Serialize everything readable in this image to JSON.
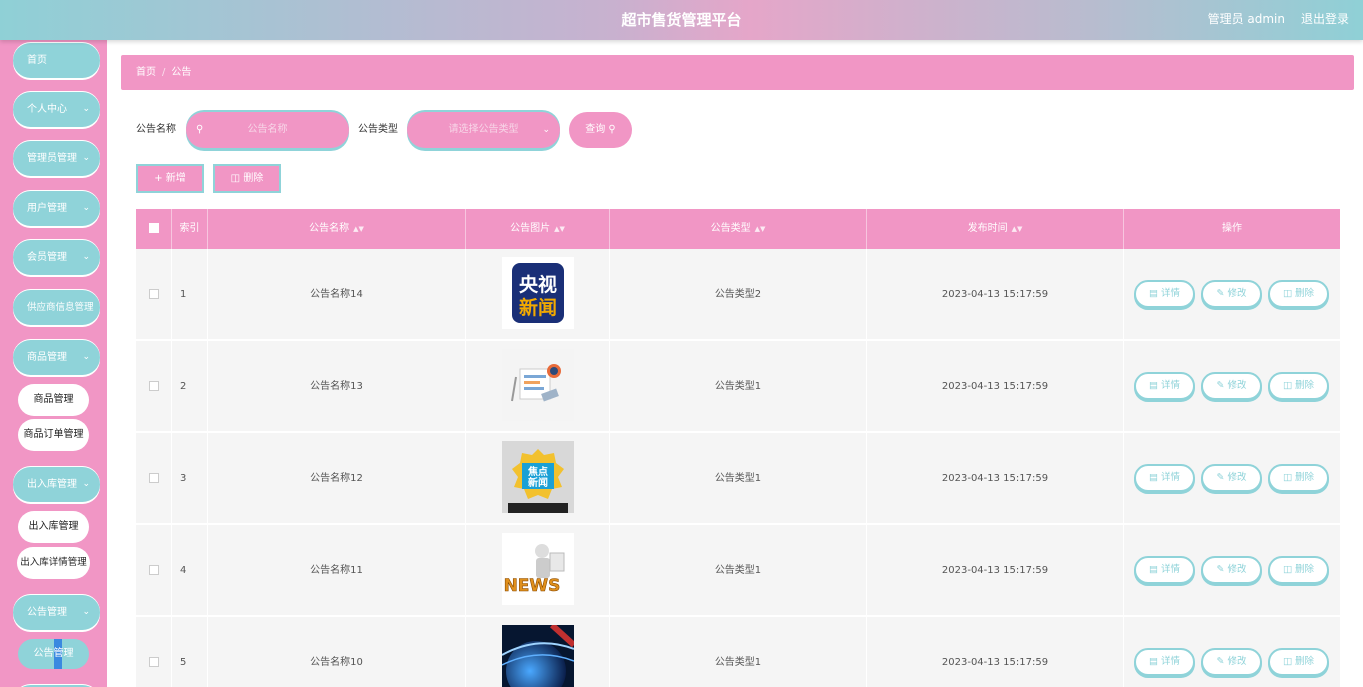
{
  "app": {
    "title": "超市售货管理平台",
    "admin_label": "管理员 admin",
    "logout": "退出登录"
  },
  "sidebar": {
    "items": [
      {
        "label": "首页"
      },
      {
        "label": "个人中心"
      },
      {
        "label": "管理员管理"
      },
      {
        "label": "用户管理"
      },
      {
        "label": "会员管理"
      },
      {
        "label": "供应商信息管理"
      },
      {
        "label": "商品管理"
      },
      {
        "label": "出入库管理"
      },
      {
        "label": "公告管理"
      }
    ],
    "sub_items": [
      {
        "label": "商品管理"
      },
      {
        "label": "商品订单管理"
      },
      {
        "label": "出入库管理"
      },
      {
        "label": "出入库详情管理"
      },
      {
        "label": "公告管理"
      }
    ]
  },
  "breadcrumb": {
    "home": "首页",
    "current": "公告"
  },
  "search": {
    "name_label": "公告名称",
    "name_placeholder": "公告名称",
    "type_label": "公告类型",
    "type_placeholder": "请选择公告类型",
    "query_label": "查询"
  },
  "actions": {
    "add_label": "新增",
    "delete_label": "删除"
  },
  "table": {
    "columns": [
      "索引",
      "公告名称",
      "公告图片",
      "公告类型",
      "发布时间",
      "操作"
    ],
    "op_labels": {
      "detail": "详情",
      "edit": "修改",
      "delete": "删除"
    },
    "rows": [
      {
        "index": "1",
        "name": "公告名称14",
        "image": "央视新闻",
        "type": "公告类型2",
        "time": "2023-04-13 15:17:59"
      },
      {
        "index": "2",
        "name": "公告名称13",
        "image": "NEWS",
        "type": "公告类型1",
        "time": "2023-04-13 15:17:59"
      },
      {
        "index": "3",
        "name": "公告名称12",
        "image": "焦点新闻",
        "type": "公告类型1",
        "time": "2023-04-13 15:17:59"
      },
      {
        "index": "4",
        "name": "公告名称11",
        "image": "NEWS",
        "type": "公告类型1",
        "time": "2023-04-13 15:17:59"
      },
      {
        "index": "5",
        "name": "公告名称10",
        "image": "",
        "type": "公告类型1",
        "time": "2023-04-13 15:17:59"
      }
    ]
  },
  "colors": {
    "pink": "#f196c5",
    "teal": "#8fd3d9"
  }
}
